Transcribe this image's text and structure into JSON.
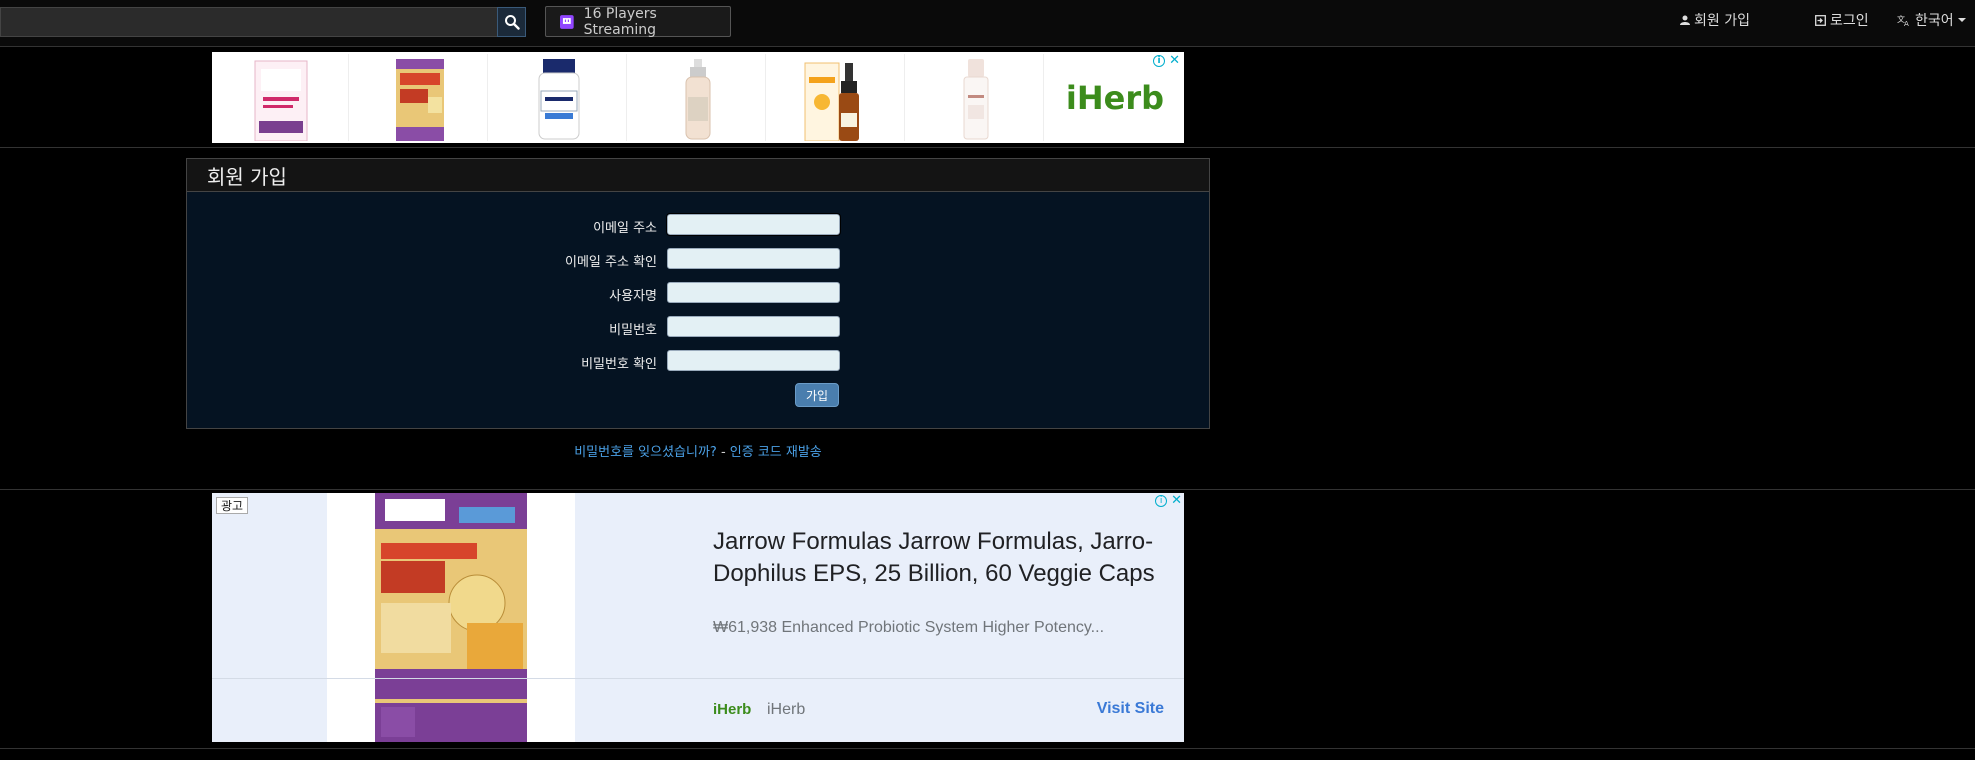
{
  "nav": {
    "search_placeholder": "",
    "stream_label": "16 Players Streaming",
    "signup": "회원 가입",
    "login": "로그인",
    "language": "한국어"
  },
  "ad_top": {
    "brand": "iHerb"
  },
  "signup_form": {
    "title": "회원 가입",
    "fields": [
      {
        "label": "이메일 주소",
        "value": ""
      },
      {
        "label": "이메일 주소 확인",
        "value": ""
      },
      {
        "label": "사용자명",
        "value": ""
      },
      {
        "label": "비밀번호",
        "value": ""
      },
      {
        "label": "비밀번호 확인",
        "value": ""
      }
    ],
    "submit_label": "가입"
  },
  "links": {
    "forgot_password": "비밀번호를 잊으셨습니까?",
    "separator": " - ",
    "resend_code": "인증 코드 재발송"
  },
  "ad_bottom": {
    "label": "광고",
    "title": "Jarrow Formulas Jarrow Formulas, Jarro-Dophilus EPS, 25 Billion, 60 Veggie Caps",
    "description": "₩61,938 Enhanced Probiotic System Higher Potency...",
    "logo": "iHerb",
    "advertiser": "iHerb",
    "cta": "Visit Site"
  },
  "colors": {
    "accent_link": "#4aa0e6",
    "panel_bg": "#051322",
    "button": "#4a7eae",
    "iherb_green": "#3c8c1c"
  }
}
